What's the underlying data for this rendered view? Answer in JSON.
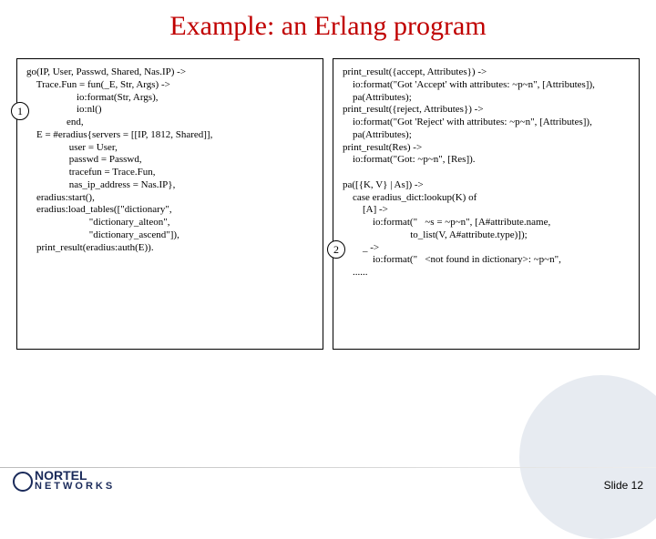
{
  "title": "Example: an Erlang program",
  "badge1": "1",
  "badge2": "2",
  "code_left": "go(IP, User, Passwd, Shared, Nas.IP) ->\n    Trace.Fun = fun(_E, Str, Args) ->\n                    io:format(Str, Args),\n                    io:nl()\n                end,\n    E = #eradius{servers = [[IP, 1812, Shared]],\n                 user = User,\n                 passwd = Passwd,\n                 tracefun = Trace.Fun,\n                 nas_ip_address = Nas.IP},\n    eradius:start(),\n    eradius:load_tables([\"dictionary\",\n                         \"dictionary_alteon\",\n                         \"dictionary_ascend\"]),\n    print_result(eradius:auth(E)).",
  "code_right": "print_result({accept, Attributes}) ->\n    io:format(\"Got 'Accept' with attributes: ~p~n\", [Attributes]),\n    pa(Attributes);\nprint_result({reject, Attributes}) ->\n    io:format(\"Got 'Reject' with attributes: ~p~n\", [Attributes]),\n    pa(Attributes);\nprint_result(Res) ->\n    io:format(\"Got: ~p~n\", [Res]).\n\npa([{K, V} | As]) ->\n    case eradius_dict:lookup(K) of\n        [A] ->\n            io:format(\"   ~s = ~p~n\", [A#attribute.name,\n                           to_list(V, A#attribute.type)]);\n        _ ->\n            io:format(\"   <not found in dictionary>: ~p~n\",\n    ......",
  "logo": {
    "line1": "NORTEL",
    "line2": "NETWORKS"
  },
  "slide_label": "Slide 12"
}
